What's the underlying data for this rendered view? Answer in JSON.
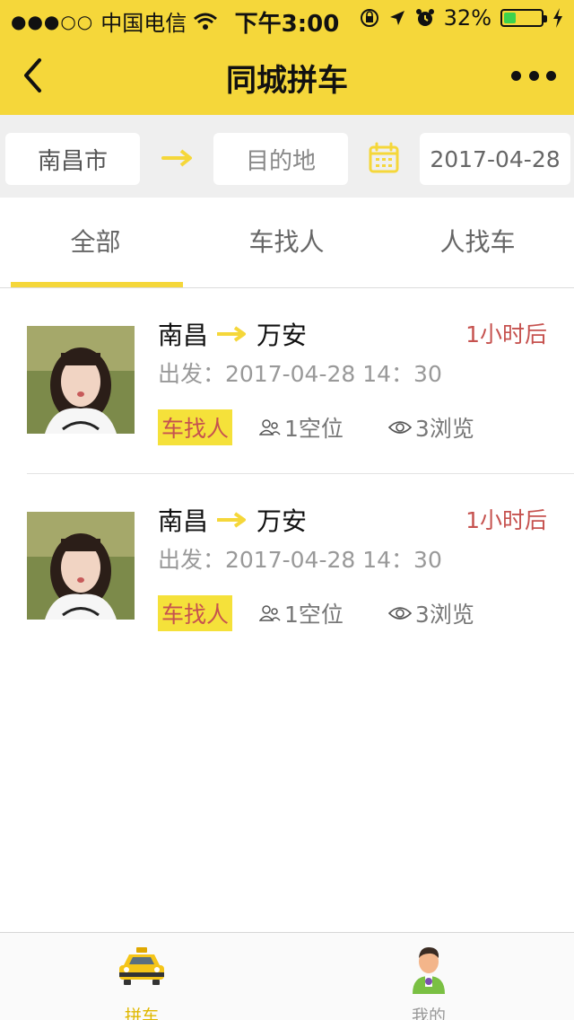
{
  "status_bar": {
    "signal": "●●●○○",
    "carrier": "中国电信",
    "time": "下午3:00",
    "battery_percent": "32%",
    "battery_level": 0.32
  },
  "nav": {
    "title": "同城拼车"
  },
  "filter": {
    "origin": "南昌市",
    "destination_placeholder": "目的地",
    "date": "2017-04-28"
  },
  "tabs": [
    {
      "label": "全部",
      "active": true
    },
    {
      "label": "车找人",
      "active": false
    },
    {
      "label": "人找车",
      "active": false
    }
  ],
  "listings": [
    {
      "from": "南昌",
      "to": "万安",
      "departure": "出发：2017-04-28 14：30",
      "type_tag": "车找人",
      "seats": "1空位",
      "views": "3浏览",
      "when": "1小时后"
    },
    {
      "from": "南昌",
      "to": "万安",
      "departure": "出发：2017-04-28 14：30",
      "type_tag": "车找人",
      "seats": "1空位",
      "views": "3浏览",
      "when": "1小时后"
    }
  ],
  "bottom_tabs": [
    {
      "label": "拼车",
      "icon": "taxi-icon",
      "active": true
    },
    {
      "label": "我的",
      "icon": "user-avatar-icon",
      "active": false
    }
  ],
  "colors": {
    "accent": "#f5d73a",
    "time_red": "#c6524f",
    "active_tab_label": "#e0b800"
  }
}
